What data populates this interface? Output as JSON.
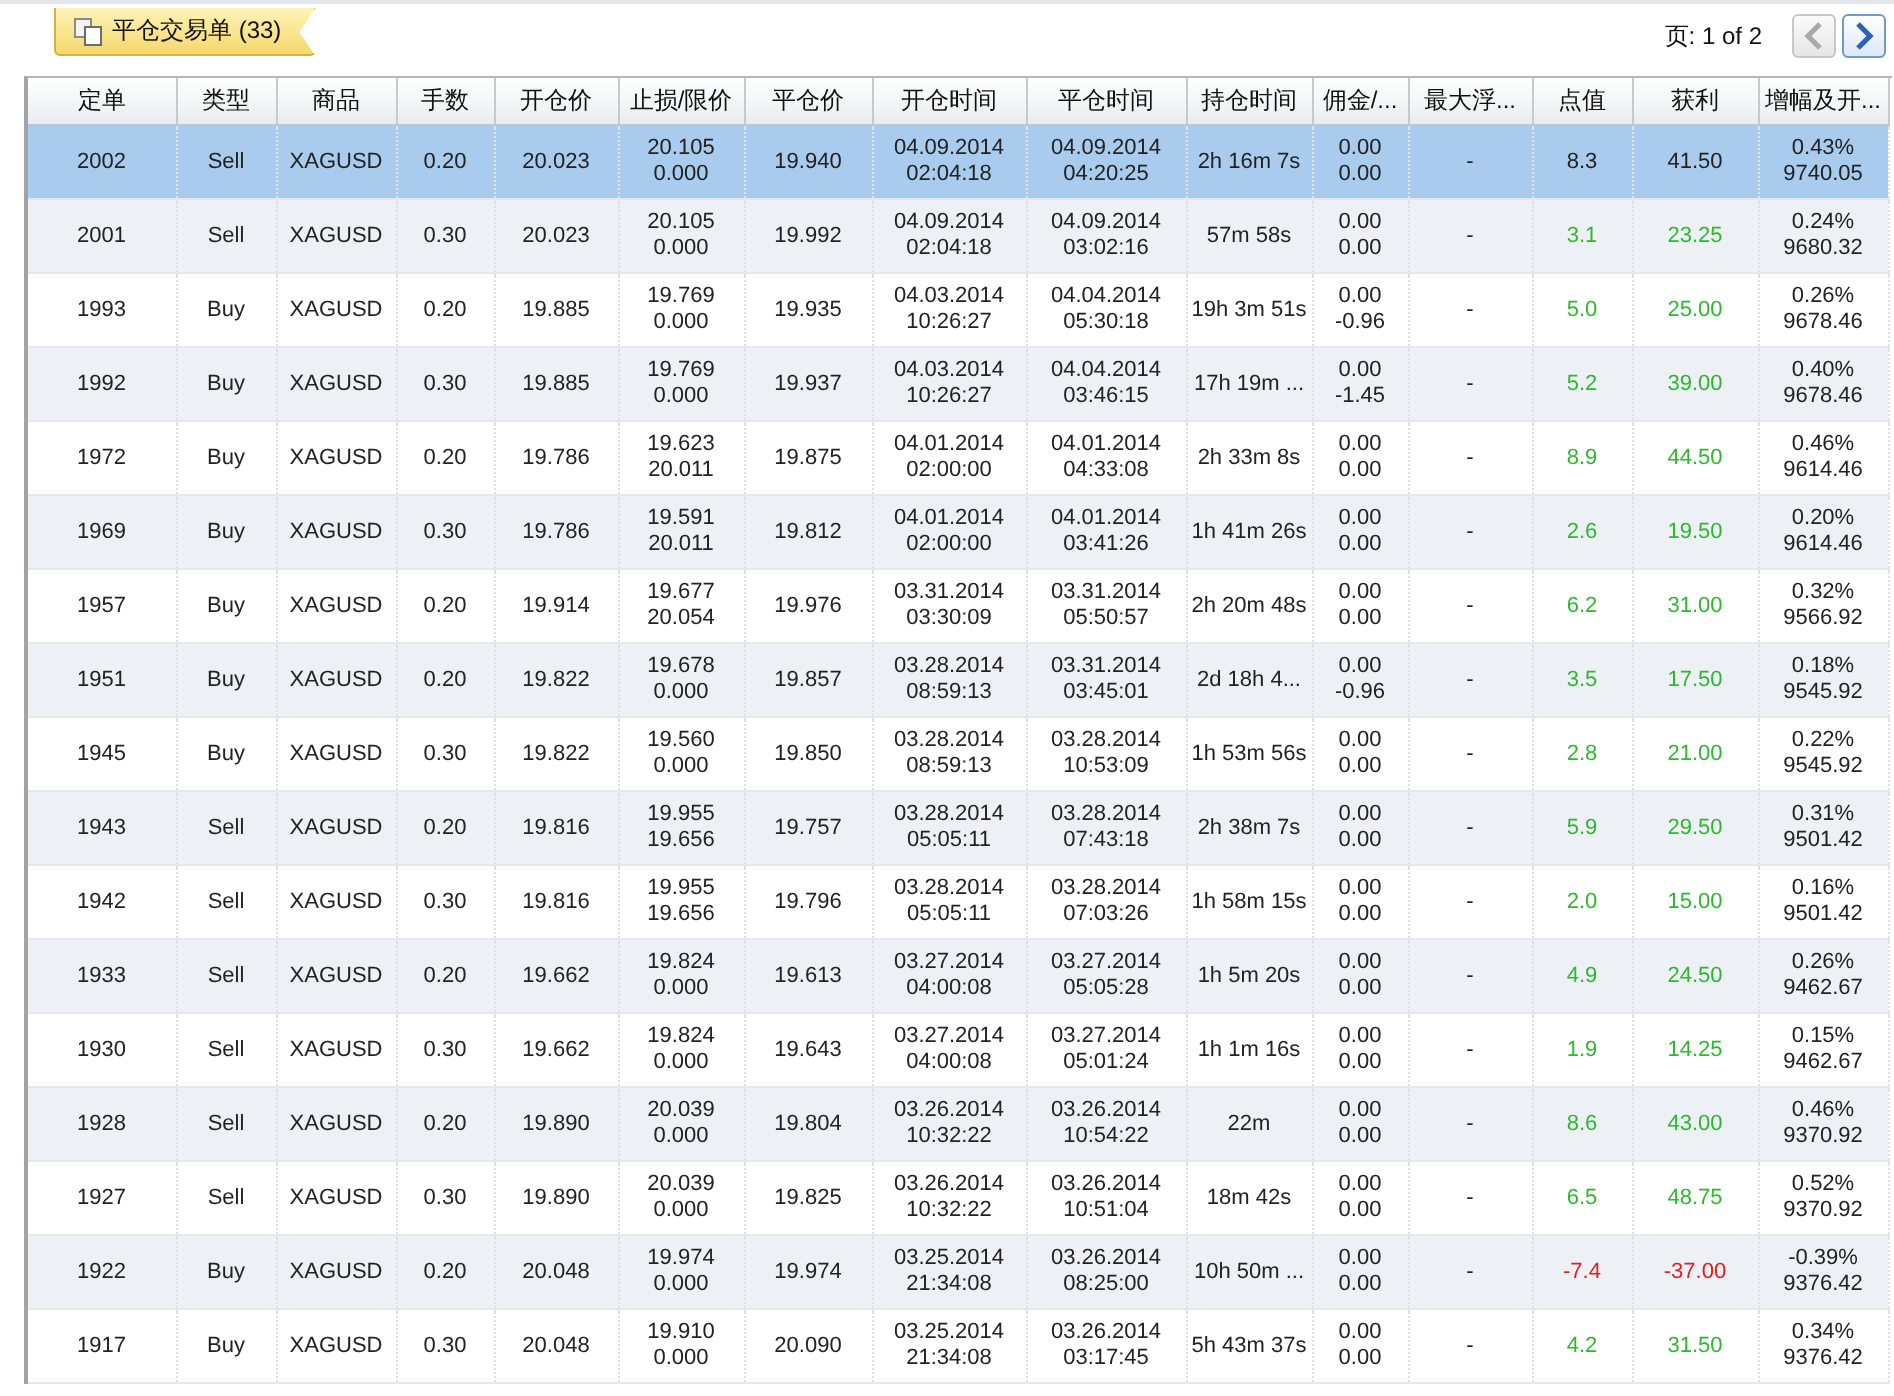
{
  "tab": {
    "label": "平仓交易单 (33)",
    "selected": true
  },
  "pager": {
    "label": "页: 1 of 2",
    "prev": {
      "disabled": true
    },
    "next": {
      "disabled": false
    }
  },
  "table": {
    "columns": [
      "定单",
      "类型",
      "商品",
      "手数",
      "开仓价",
      "止损/限价",
      "平仓价",
      "开仓时间",
      "平仓时间",
      "持仓时间",
      "佣金/...",
      "最大浮...",
      "点值",
      "获利",
      "增幅及开..."
    ],
    "rows": [
      {
        "selected": true,
        "cells": [
          "2002",
          "Sell",
          "XAGUSD",
          "0.20",
          "20.023",
          "20.105\n0.000",
          "19.940",
          "04.09.2014\n02:04:18",
          "04.09.2014\n04:20:25",
          "2h 16m 7s",
          "0.00\n0.00",
          "-",
          "8.3",
          "41.50",
          "0.43%\n9740.05"
        ]
      },
      {
        "selected": false,
        "color": "#2db82d",
        "cells": [
          "2001",
          "Sell",
          "XAGUSD",
          "0.30",
          "20.023",
          "20.105\n0.000",
          "19.992",
          "04.09.2014\n02:04:18",
          "04.09.2014\n03:02:16",
          "57m 58s",
          "0.00\n0.00",
          "-",
          "3.1",
          "23.25",
          "0.24%\n9680.32"
        ]
      },
      {
        "selected": false,
        "color": "#2db82d",
        "cells": [
          "1993",
          "Buy",
          "XAGUSD",
          "0.20",
          "19.885",
          "19.769\n0.000",
          "19.935",
          "04.03.2014\n10:26:27",
          "04.04.2014\n05:30:18",
          "19h 3m 51s",
          "0.00\n-0.96",
          "-",
          "5.0",
          "25.00",
          "0.26%\n9678.46"
        ]
      },
      {
        "selected": false,
        "color": "#2db82d",
        "cells": [
          "1992",
          "Buy",
          "XAGUSD",
          "0.30",
          "19.885",
          "19.769\n0.000",
          "19.937",
          "04.03.2014\n10:26:27",
          "04.04.2014\n03:46:15",
          "17h 19m ...",
          "0.00\n-1.45",
          "-",
          "5.2",
          "39.00",
          "0.40%\n9678.46"
        ]
      },
      {
        "selected": false,
        "color": "#2db82d",
        "cells": [
          "1972",
          "Buy",
          "XAGUSD",
          "0.20",
          "19.786",
          "19.623\n20.011",
          "19.875",
          "04.01.2014\n02:00:00",
          "04.01.2014\n04:33:08",
          "2h 33m 8s",
          "0.00\n0.00",
          "-",
          "8.9",
          "44.50",
          "0.46%\n9614.46"
        ]
      },
      {
        "selected": false,
        "color": "#2db82d",
        "cells": [
          "1969",
          "Buy",
          "XAGUSD",
          "0.30",
          "19.786",
          "19.591\n20.011",
          "19.812",
          "04.01.2014\n02:00:00",
          "04.01.2014\n03:41:26",
          "1h 41m 26s",
          "0.00\n0.00",
          "-",
          "2.6",
          "19.50",
          "0.20%\n9614.46"
        ]
      },
      {
        "selected": false,
        "color": "#2db82d",
        "cells": [
          "1957",
          "Buy",
          "XAGUSD",
          "0.20",
          "19.914",
          "19.677\n20.054",
          "19.976",
          "03.31.2014\n03:30:09",
          "03.31.2014\n05:50:57",
          "2h 20m 48s",
          "0.00\n0.00",
          "-",
          "6.2",
          "31.00",
          "0.32%\n9566.92"
        ]
      },
      {
        "selected": false,
        "color": "#2db82d",
        "cells": [
          "1951",
          "Buy",
          "XAGUSD",
          "0.20",
          "19.822",
          "19.678\n0.000",
          "19.857",
          "03.28.2014\n08:59:13",
          "03.31.2014\n03:45:01",
          "2d 18h 4...",
          "0.00\n-0.96",
          "-",
          "3.5",
          "17.50",
          "0.18%\n9545.92"
        ]
      },
      {
        "selected": false,
        "color": "#2db82d",
        "cells": [
          "1945",
          "Buy",
          "XAGUSD",
          "0.30",
          "19.822",
          "19.560\n0.000",
          "19.850",
          "03.28.2014\n08:59:13",
          "03.28.2014\n10:53:09",
          "1h 53m 56s",
          "0.00\n0.00",
          "-",
          "2.8",
          "21.00",
          "0.22%\n9545.92"
        ]
      },
      {
        "selected": false,
        "color": "#2db82d",
        "cells": [
          "1943",
          "Sell",
          "XAGUSD",
          "0.20",
          "19.816",
          "19.955\n19.656",
          "19.757",
          "03.28.2014\n05:05:11",
          "03.28.2014\n07:43:18",
          "2h 38m 7s",
          "0.00\n0.00",
          "-",
          "5.9",
          "29.50",
          "0.31%\n9501.42"
        ]
      },
      {
        "selected": false,
        "color": "#2db82d",
        "cells": [
          "1942",
          "Sell",
          "XAGUSD",
          "0.30",
          "19.816",
          "19.955\n19.656",
          "19.796",
          "03.28.2014\n05:05:11",
          "03.28.2014\n07:03:26",
          "1h 58m 15s",
          "0.00\n0.00",
          "-",
          "2.0",
          "15.00",
          "0.16%\n9501.42"
        ]
      },
      {
        "selected": false,
        "color": "#2db82d",
        "cells": [
          "1933",
          "Sell",
          "XAGUSD",
          "0.20",
          "19.662",
          "19.824\n0.000",
          "19.613",
          "03.27.2014\n04:00:08",
          "03.27.2014\n05:05:28",
          "1h 5m 20s",
          "0.00\n0.00",
          "-",
          "4.9",
          "24.50",
          "0.26%\n9462.67"
        ]
      },
      {
        "selected": false,
        "color": "#2db82d",
        "cells": [
          "1930",
          "Sell",
          "XAGUSD",
          "0.30",
          "19.662",
          "19.824\n0.000",
          "19.643",
          "03.27.2014\n04:00:08",
          "03.27.2014\n05:01:24",
          "1h 1m 16s",
          "0.00\n0.00",
          "-",
          "1.9",
          "14.25",
          "0.15%\n9462.67"
        ]
      },
      {
        "selected": false,
        "color": "#2db82d",
        "cells": [
          "1928",
          "Sell",
          "XAGUSD",
          "0.20",
          "19.890",
          "20.039\n0.000",
          "19.804",
          "03.26.2014\n10:32:22",
          "03.26.2014\n10:54:22",
          "22m",
          "0.00\n0.00",
          "-",
          "8.6",
          "43.00",
          "0.46%\n9370.92"
        ]
      },
      {
        "selected": false,
        "color": "#2db82d",
        "cells": [
          "1927",
          "Sell",
          "XAGUSD",
          "0.30",
          "19.890",
          "20.039\n0.000",
          "19.825",
          "03.26.2014\n10:32:22",
          "03.26.2014\n10:51:04",
          "18m 42s",
          "0.00\n0.00",
          "-",
          "6.5",
          "48.75",
          "0.52%\n9370.92"
        ]
      },
      {
        "selected": false,
        "color": "#e02020",
        "cells": [
          "1922",
          "Buy",
          "XAGUSD",
          "0.20",
          "20.048",
          "19.974\n0.000",
          "19.974",
          "03.25.2014\n21:34:08",
          "03.26.2014\n08:25:00",
          "10h 50m ...",
          "0.00\n0.00",
          "-",
          "-7.4",
          "-37.00",
          "-0.39%\n9376.42"
        ]
      },
      {
        "selected": false,
        "color": "#2db82d",
        "cells": [
          "1917",
          "Buy",
          "XAGUSD",
          "0.30",
          "20.048",
          "19.910\n0.000",
          "20.090",
          "03.25.2014\n21:34:08",
          "03.26.2014\n03:17:45",
          "5h 43m 37s",
          "0.00\n0.00",
          "-",
          "4.2",
          "31.50",
          "0.34%\n9376.42"
        ]
      }
    ]
  }
}
